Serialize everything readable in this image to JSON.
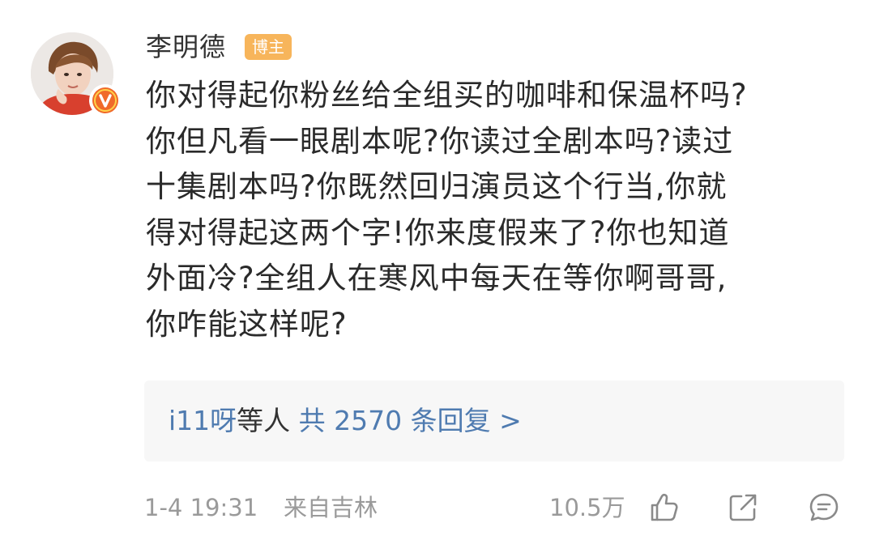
{
  "comment": {
    "author": {
      "name": "李明德",
      "badge": "博主",
      "verified_icon": "verified-v-icon",
      "verified_color": "#f06a29"
    },
    "text_lines": [
      "你对得起你粉丝给全组买的咖啡和保温杯吗?",
      "你但凡看一眼剧本呢?你读过全剧本吗?读过",
      "十集剧本吗?你既然回归演员这个行当,你就",
      "得对得起这两个字!你来度假来了?你也知道",
      "外面冷?全组人在寒风中每天在等你啊哥哥,",
      "你咋能这样呢?"
    ],
    "replies": {
      "users": "i11呀",
      "connector": "等人",
      "summary": "共 2570 条回复 >"
    },
    "footer": {
      "timestamp": "1-4 19:31",
      "location": "来自吉林",
      "like_count": "10.5万",
      "like_icon": "thumbs-up-icon",
      "share_icon": "share-icon",
      "reply_icon": "comment-icon"
    },
    "colors": {
      "link": "#4f7bb0",
      "badge_bg": "#f7b55b",
      "meta_text": "#9a9a9a",
      "reply_box_bg": "#f7f7f7"
    }
  }
}
